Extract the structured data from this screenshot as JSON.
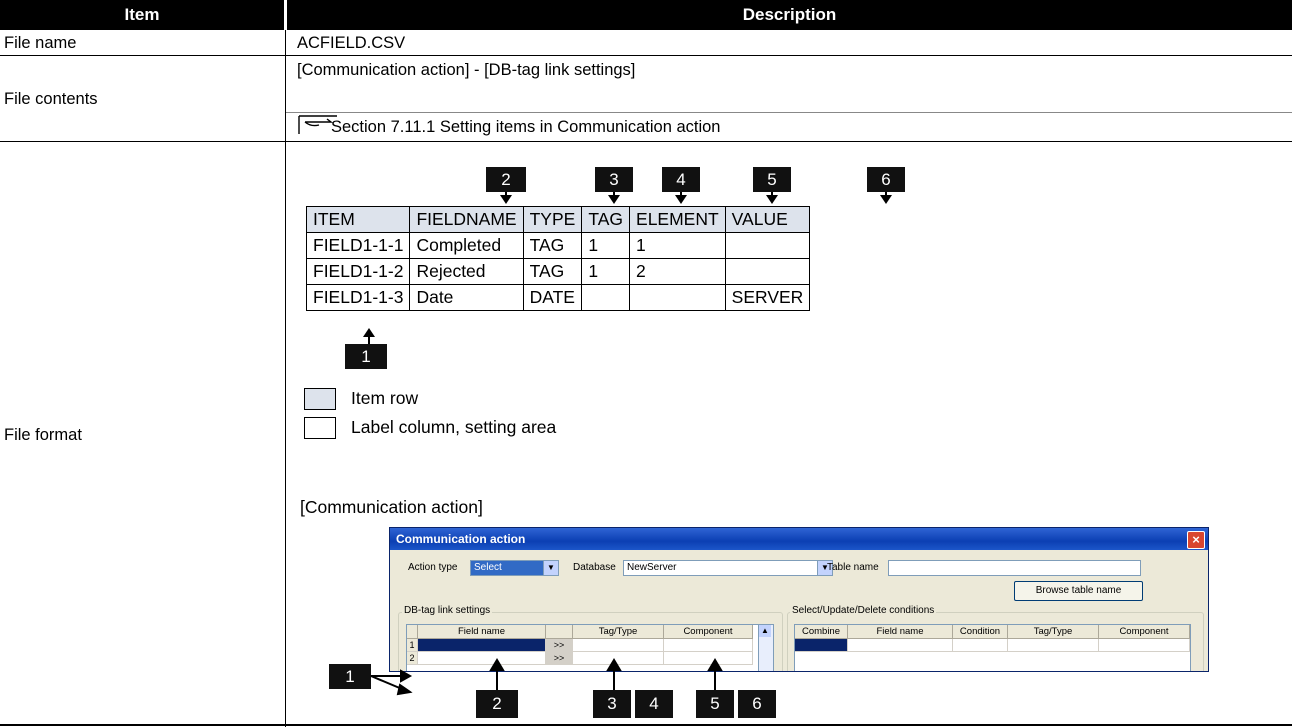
{
  "header": {
    "item": "Item",
    "description": "Description"
  },
  "rows": {
    "file_name": {
      "label": "File name",
      "value": "ACFIELD.CSV"
    },
    "file_contents": {
      "label": "File contents",
      "path": "[Communication action] - [DB-tag link settings]",
      "ref": "Section 7.11.1 Setting items in Communication action"
    },
    "file_format": {
      "label": "File format"
    }
  },
  "sample": {
    "columns": [
      "ITEM",
      "FIELDNAME",
      "TYPE",
      "TAG",
      "ELEMENT",
      "VALUE"
    ],
    "rows": [
      [
        "FIELD1-1-1",
        "Completed",
        "TAG",
        "1",
        "1",
        ""
      ],
      [
        "FIELD1-1-2",
        "Rejected",
        "TAG",
        "1",
        "2",
        ""
      ],
      [
        "FIELD1-1-3",
        "Date",
        "DATE",
        "",
        "",
        "SERVER"
      ]
    ]
  },
  "badges": {
    "b1": "1",
    "b2": "2",
    "b3": "3",
    "b4": "4",
    "b5": "5",
    "b6": "6"
  },
  "legend": {
    "item_row": "Item row",
    "label_column": "Label column, setting area"
  },
  "screen_caption": "[Communication action]",
  "dialog": {
    "title": "Communication action",
    "action_type_label": "Action type",
    "action_type_value": "Select",
    "database_label": "Database",
    "database_value": "NewServer",
    "table_name_label": "Table name",
    "table_name_value": "",
    "browse_button": "Browse table name",
    "dbtag_group": "DB-tag link settings",
    "dbtag_cols": [
      "Field name",
      "Tag/Type",
      "Component"
    ],
    "dbtag_rows": [
      "1",
      "2"
    ],
    "move_button": ">>",
    "conditions_group": "Select/Update/Delete conditions",
    "cond_cols": [
      "Combine",
      "Field name",
      "Condition",
      "Tag/Type",
      "Component"
    ]
  },
  "colors": {
    "item_row_bg": "#dde3ec",
    "badge_bg": "#111111",
    "dialog_title": "#0b3fb3"
  }
}
